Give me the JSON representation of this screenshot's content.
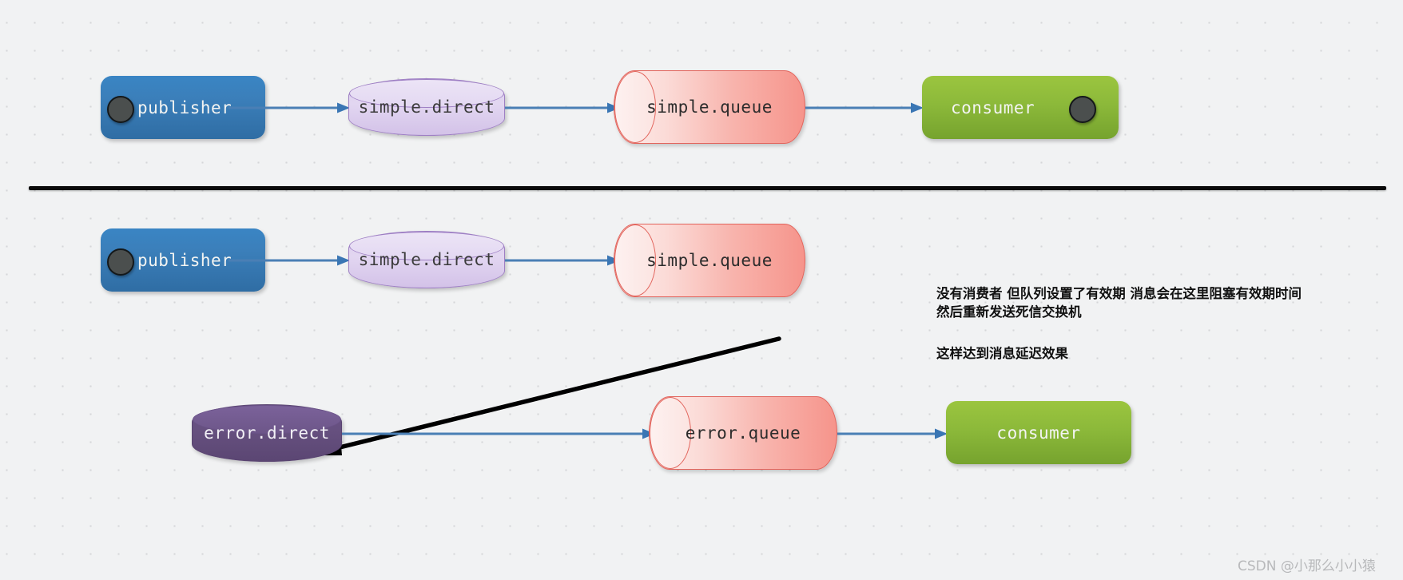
{
  "diagram": {
    "title": "RabbitMQ dead-letter delay diagram",
    "colors": {
      "background": "#f1f2f3",
      "grid_dot": "#d6d7d9",
      "publisher_blue": "#3b7fba",
      "consumer_green": "#8cb93a",
      "exchange_purple_light": "#ddd0ee",
      "exchange_purple_dark": "#665080",
      "queue_pink": "#f8b4ad",
      "arrow_blue": "#4a7fb5",
      "arrow_black": "#000000",
      "port_dot": "#4b4f4e"
    },
    "row_top": {
      "nodes": {
        "publisher": {
          "label": "publisher",
          "type": "rounded-box"
        },
        "exchange": {
          "label": "simple.direct",
          "type": "cylinder-vertical"
        },
        "queue": {
          "label": "simple.queue",
          "type": "cylinder-horizontal"
        },
        "consumer": {
          "label": "consumer",
          "type": "rounded-box"
        }
      },
      "edges": [
        {
          "from": "publisher",
          "to": "simple.direct",
          "style": "blue-arrow"
        },
        {
          "from": "simple.direct",
          "to": "simple.queue",
          "style": "blue-arrow"
        },
        {
          "from": "simple.queue",
          "to": "consumer",
          "style": "blue-arrow"
        }
      ]
    },
    "row_bottom": {
      "nodes": {
        "publisher": {
          "label": "publisher",
          "type": "rounded-box"
        },
        "exchange": {
          "label": "simple.direct",
          "type": "cylinder-vertical"
        },
        "queue": {
          "label": "simple.queue",
          "type": "cylinder-horizontal"
        },
        "dead_exchange": {
          "label": "error.direct",
          "type": "cylinder-vertical"
        },
        "dead_queue": {
          "label": "error.queue",
          "type": "cylinder-horizontal"
        },
        "consumer": {
          "label": "consumer",
          "type": "rounded-box"
        }
      },
      "edges": [
        {
          "from": "publisher",
          "to": "simple.direct",
          "style": "blue-arrow"
        },
        {
          "from": "simple.direct",
          "to": "simple.queue",
          "style": "blue-arrow"
        },
        {
          "from": "simple.queue",
          "to": "error.direct",
          "style": "black-arrow"
        },
        {
          "from": "error.direct",
          "to": "error.queue",
          "style": "blue-arrow"
        },
        {
          "from": "error.queue",
          "to": "consumer",
          "style": "blue-arrow"
        }
      ]
    },
    "annotations": [
      {
        "id": "ttl-note",
        "line1": "没有消费者 但队列设置了有效期 消息会在这里阻塞有效期时间",
        "line2": "然后重新发送死信交换机"
      },
      {
        "id": "delay-note",
        "line1": "这样达到消息延迟效果"
      }
    ],
    "watermark": "CSDN @小那么小小猿"
  }
}
